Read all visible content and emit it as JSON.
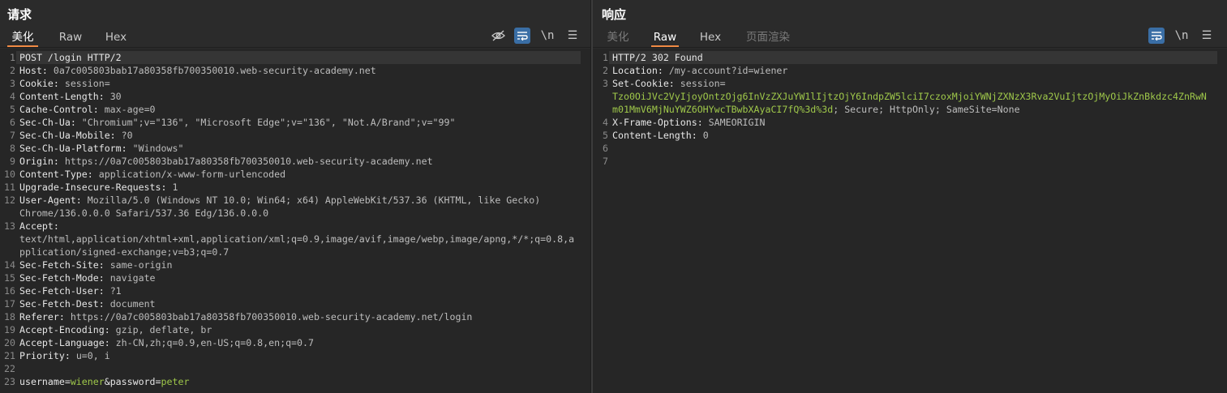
{
  "request": {
    "title": "请求",
    "tabs": [
      "美化",
      "Raw",
      "Hex"
    ],
    "active_tab": "美化",
    "tools": {
      "hide": "eye-slash-icon",
      "wrap": "wrap-icon",
      "newline": "\\n",
      "menu": "☰"
    },
    "lines": [
      {
        "n": "1",
        "k": "POST /login HTTP/2",
        "v": ""
      },
      {
        "n": "2",
        "k": "Host: ",
        "v": "0a7c005803bab17a80358fb700350010.web-security-academy.net"
      },
      {
        "n": "3",
        "k": "Cookie: ",
        "v": "session="
      },
      {
        "n": "4",
        "k": "Content-Length: ",
        "v": "30"
      },
      {
        "n": "5",
        "k": "Cache-Control: ",
        "v": "max-age=0"
      },
      {
        "n": "6",
        "k": "Sec-Ch-Ua: ",
        "v": "\"Chromium\";v=\"136\", \"Microsoft Edge\";v=\"136\", \"Not.A/Brand\";v=\"99\""
      },
      {
        "n": "7",
        "k": "Sec-Ch-Ua-Mobile: ",
        "v": "?0"
      },
      {
        "n": "8",
        "k": "Sec-Ch-Ua-Platform: ",
        "v": "\"Windows\""
      },
      {
        "n": "9",
        "k": "Origin: ",
        "v": "https://0a7c005803bab17a80358fb700350010.web-security-academy.net"
      },
      {
        "n": "10",
        "k": "Content-Type: ",
        "v": "application/x-www-form-urlencoded"
      },
      {
        "n": "11",
        "k": "Upgrade-Insecure-Requests: ",
        "v": "1"
      },
      {
        "n": "12",
        "k": "User-Agent: ",
        "v": "Mozilla/5.0 (Windows NT 10.0; Win64; x64) AppleWebKit/537.36 (KHTML, like Gecko)"
      },
      {
        "n": "",
        "k": "",
        "v": "Chrome/136.0.0.0 Safari/537.36 Edg/136.0.0.0"
      },
      {
        "n": "13",
        "k": "Accept: ",
        "v": ""
      },
      {
        "n": "",
        "k": "",
        "v": "text/html,application/xhtml+xml,application/xml;q=0.9,image/avif,image/webp,image/apng,*/*;q=0.8,a"
      },
      {
        "n": "",
        "k": "",
        "v": "pplication/signed-exchange;v=b3;q=0.7"
      },
      {
        "n": "14",
        "k": "Sec-Fetch-Site: ",
        "v": "same-origin"
      },
      {
        "n": "15",
        "k": "Sec-Fetch-Mode: ",
        "v": "navigate"
      },
      {
        "n": "16",
        "k": "Sec-Fetch-User: ",
        "v": "?1"
      },
      {
        "n": "17",
        "k": "Sec-Fetch-Dest: ",
        "v": "document"
      },
      {
        "n": "18",
        "k": "Referer: ",
        "v": "https://0a7c005803bab17a80358fb700350010.web-security-academy.net/login"
      },
      {
        "n": "19",
        "k": "Accept-Encoding: ",
        "v": "gzip, deflate, br"
      },
      {
        "n": "20",
        "k": "Accept-Language: ",
        "v": "zh-CN,zh;q=0.9,en-US;q=0.8,en;q=0.7"
      },
      {
        "n": "21",
        "k": "Priority: ",
        "v": "u=0, i"
      },
      {
        "n": "22",
        "k": "",
        "v": ""
      },
      {
        "n": "23",
        "k": "",
        "v": "",
        "body": [
          [
            "username=",
            "k"
          ],
          [
            "wiener",
            "g"
          ],
          [
            "&password=",
            "k"
          ],
          [
            "peter",
            "g"
          ]
        ]
      }
    ]
  },
  "response": {
    "title": "响应",
    "tabs": [
      "美化",
      "Raw",
      "Hex",
      "页面渲染"
    ],
    "active_tab": "Raw",
    "tools": {
      "wrap": "wrap-icon",
      "newline": "\\n",
      "menu": "☰"
    },
    "lines": [
      {
        "n": "1",
        "k": "HTTP/2 302 Found",
        "v": ""
      },
      {
        "n": "2",
        "k": "Location: ",
        "v": "/my-account?id=wiener"
      },
      {
        "n": "3",
        "k": "Set-Cookie: ",
        "v": "session="
      },
      {
        "n": "",
        "k": "",
        "v": "",
        "body": [
          [
            "Tzo0OiJVc2VyIjoyOntzOjg6InVzZXJuYW1lIjtzOjY6IndpZW5lciI7czoxMjoiYWNjZXNzX3Rva2VuIjtzOjMyOiJkZnBkdzc4ZnRwN",
            "g"
          ]
        ]
      },
      {
        "n": "",
        "k": "",
        "v": "",
        "body": [
          [
            "m01MmV6MjNuYWZ6OHYwcTBwbXAyaCI7fQ%3d%3d",
            "g"
          ],
          [
            "; Secure; HttpOnly; SameSite=None",
            "v"
          ]
        ]
      },
      {
        "n": "4",
        "k": "X-Frame-Options: ",
        "v": "SAMEORIGIN"
      },
      {
        "n": "5",
        "k": "Content-Length: ",
        "v": "0"
      },
      {
        "n": "6",
        "k": "",
        "v": ""
      },
      {
        "n": "7",
        "k": "",
        "v": ""
      }
    ]
  }
}
